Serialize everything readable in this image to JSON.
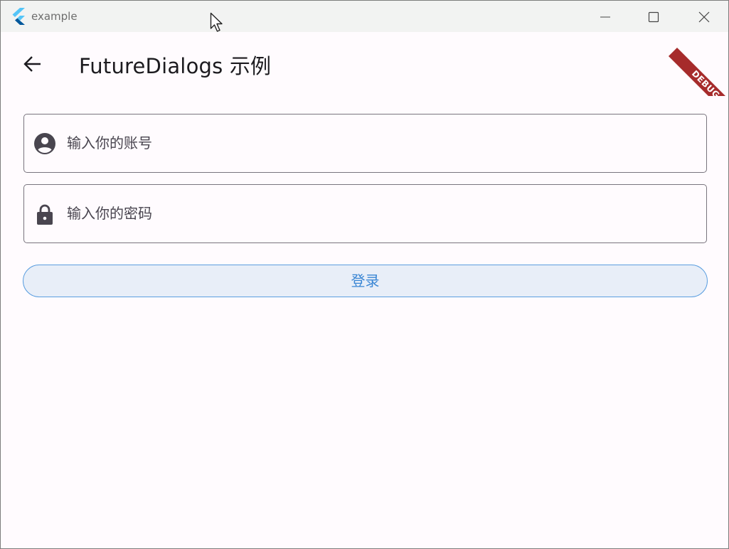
{
  "window": {
    "title": "example"
  },
  "appbar": {
    "title": "FutureDialogs 示例",
    "debug_label": "DEBUG"
  },
  "form": {
    "account_placeholder": "输入你的账号",
    "password_placeholder": "输入你的密码",
    "login_label": "登录"
  },
  "colors": {
    "accent": "#3a86d4",
    "debug_ribbon": "#a62b2b",
    "field_border": "#79747e",
    "background": "#fffbfe"
  }
}
